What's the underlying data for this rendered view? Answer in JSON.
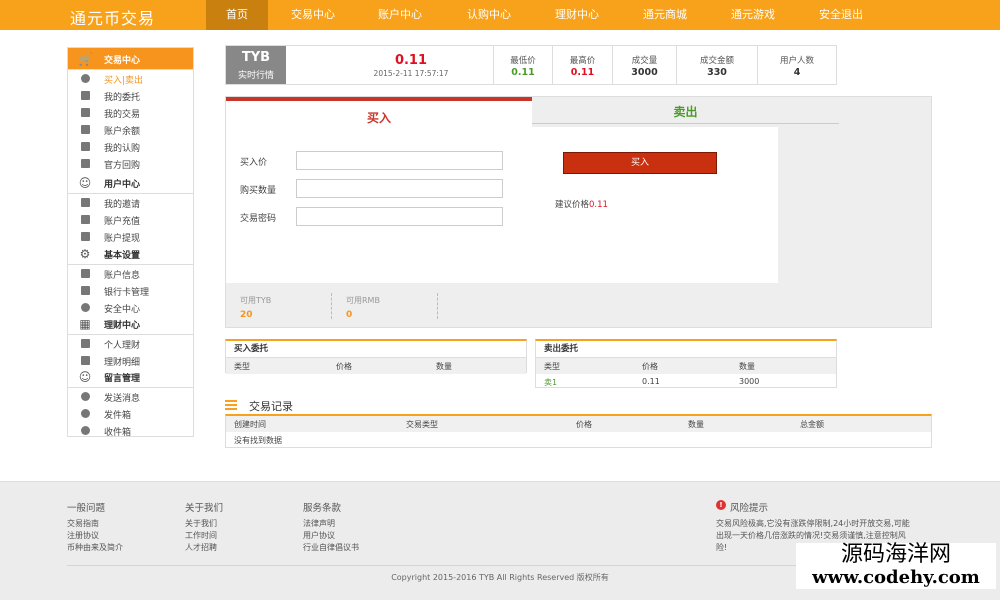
{
  "nav": {
    "brand": "通元币交易",
    "items": [
      "首页",
      "交易中心",
      "账户中心",
      "认购中心",
      "理财中心",
      "通元商城",
      "通元游戏",
      "安全退出"
    ]
  },
  "sidebar": {
    "groups": [
      {
        "title": "交易中心",
        "items": [
          "买入|卖出",
          "我的委托",
          "我的交易",
          "账户余额",
          "我的认购",
          "官方回购"
        ]
      },
      {
        "title": "用户中心",
        "items": [
          "我的邀请",
          "账户充值",
          "账户提现"
        ]
      },
      {
        "title": "基本设置",
        "items": [
          "账户信息",
          "银行卡管理",
          "安全中心"
        ]
      },
      {
        "title": "理财中心",
        "items": [
          "个人理财",
          "理财明细"
        ]
      },
      {
        "title": "留言管理",
        "items": [
          "发送消息",
          "发件箱",
          "收件箱"
        ]
      }
    ]
  },
  "ticker": {
    "coin": "TYB",
    "coin_sub": "实时行情",
    "price": "0.11",
    "time": "2015-2-11 17:57:17",
    "stats": [
      {
        "label": "最低价",
        "value": "0.11"
      },
      {
        "label": "最高价",
        "value": "0.11"
      },
      {
        "label": "成交量",
        "value": "3000"
      },
      {
        "label": "成交金额",
        "value": "330"
      },
      {
        "label": "用户人数",
        "value": "4"
      }
    ]
  },
  "trade": {
    "tab_buy": "买入",
    "tab_sell": "卖出",
    "fields": [
      {
        "label": "买入价",
        "value": ""
      },
      {
        "label": "购买数量",
        "value": ""
      },
      {
        "label": "交易密码",
        "value": ""
      }
    ],
    "buy_button": "买入",
    "hint_label": "建议价格",
    "hint_value": "0.11",
    "avail": [
      {
        "label": "可用TYB",
        "value": "20"
      },
      {
        "label": "可用RMB",
        "value": "0"
      }
    ]
  },
  "buy_orders": {
    "title": "买入委托",
    "headers": [
      "类型",
      "价格",
      "数量"
    ],
    "rows": []
  },
  "sell_orders": {
    "title": "卖出委托",
    "headers": [
      "类型",
      "价格",
      "数量"
    ],
    "rows": [
      [
        "卖1",
        "0.11",
        "3000"
      ]
    ]
  },
  "records": {
    "title": "交易记录",
    "headers": [
      "创建时间",
      "交易类型",
      "价格",
      "数量",
      "总金额"
    ],
    "empty": "没有找到数据"
  },
  "footer": {
    "cols": [
      {
        "title": "一般问题",
        "links": [
          "交易指南",
          "注册协议",
          "币种由来及简介"
        ]
      },
      {
        "title": "关于我们",
        "links": [
          "关于我们",
          "工作时间",
          "人才招聘"
        ]
      },
      {
        "title": "服务条款",
        "links": [
          "法律声明",
          "用户协议",
          "行业自律倡议书"
        ]
      }
    ],
    "risk_title": "风险提示",
    "risk_text": "交易风险极高,它没有涨跌停限制,24小时开放交易,可能出现一天价格几倍涨跌的情况!交易须谨慎,注意控制风险!",
    "copyright": "Copyright 2015-2016 TYB All Rights Reserved 版权所有"
  },
  "watermark": {
    "line1": "源码海洋网",
    "line2": "www.codehy.com"
  },
  "colors": {
    "nav_bg": "#f7a21a",
    "nav_active": "#c9800e",
    "buy_red": "#c8362a",
    "sell_green": "#4b9b2a",
    "accent_orange": "#f7941d"
  }
}
